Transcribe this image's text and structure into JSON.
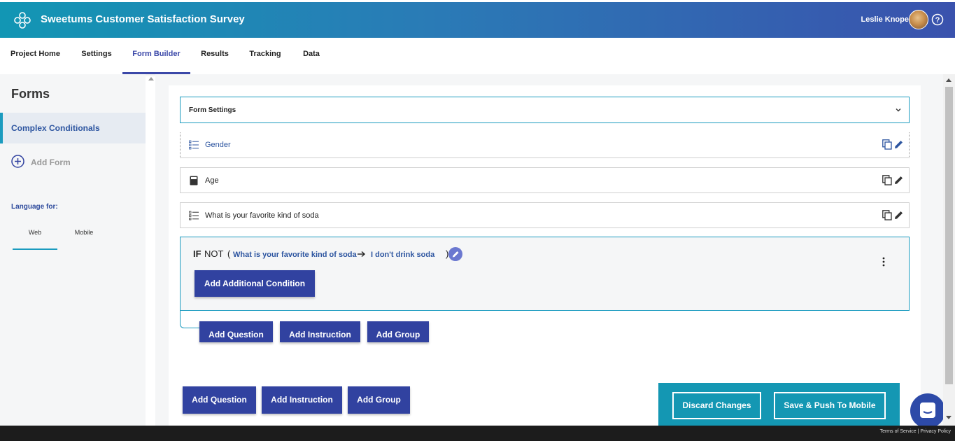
{
  "header": {
    "title": "Sweetums Customer Satisfaction Survey",
    "user_name": "Leslie Knope"
  },
  "nav": {
    "tabs": [
      {
        "label": "Project Home"
      },
      {
        "label": "Settings"
      },
      {
        "label": "Form Builder",
        "active": true
      },
      {
        "label": "Results"
      },
      {
        "label": "Tracking"
      },
      {
        "label": "Data"
      }
    ]
  },
  "sidebar": {
    "title": "Forms",
    "forms": [
      {
        "label": "Complex Conditionals"
      }
    ],
    "add_form": "Add Form",
    "language_label": "Language for:",
    "language_tabs": [
      {
        "label": "Web",
        "active": true
      },
      {
        "label": "Mobile"
      }
    ]
  },
  "builder": {
    "form_settings": "Form Settings",
    "questions": [
      {
        "label": "Gender",
        "icon": "list-icon"
      },
      {
        "label": "Age",
        "icon": "calculator-icon"
      },
      {
        "label": "What is your favorite kind of soda",
        "icon": "list-icon"
      }
    ],
    "condition": {
      "if": "IF",
      "not": "NOT",
      "open": "(",
      "question": "What is your favorite kind of soda",
      "answer": "I don't drink soda",
      "close": ")",
      "add_condition": "Add Additional Condition"
    },
    "inner_actions": {
      "add_question": "Add Question",
      "add_instruction": "Add Instruction",
      "add_group": "Add Group"
    },
    "outer_actions": {
      "add_question": "Add Question",
      "add_instruction": "Add Instruction",
      "add_group": "Add Group"
    }
  },
  "save_bar": {
    "discard": "Discard Changes",
    "save": "Save & Push To Mobile"
  },
  "footer": {
    "terms": "Terms of Service",
    "separator": "|",
    "privacy": "Privacy Policy"
  },
  "colors": {
    "header_gradient_start": "#1296b4",
    "header_gradient_end": "#3a52ad",
    "primary_button": "#3142a0",
    "accent_teal": "#1b9bbf"
  }
}
